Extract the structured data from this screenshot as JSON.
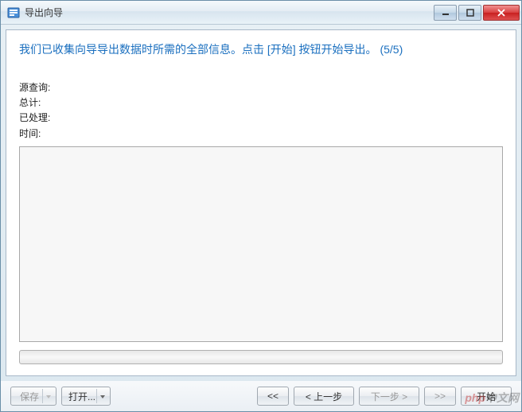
{
  "titlebar": {
    "title": "导出向导"
  },
  "instruction": "我们已收集向导导出数据时所需的全部信息。点击 [开始] 按钮开始导出。 (5/5)",
  "stats": {
    "source_label": "源查询:",
    "source_value": "",
    "total_label": "总计:",
    "total_value": "",
    "processed_label": "已处理:",
    "processed_value": "",
    "time_label": "时间:",
    "time_value": ""
  },
  "log": "",
  "footer": {
    "save": "保存",
    "open": "打开...",
    "first": "<<",
    "prev": "< 上一步",
    "next": "下一步 >",
    "last": ">>",
    "start": "开始"
  },
  "watermark": {
    "a": "php",
    "b": "中文网"
  }
}
